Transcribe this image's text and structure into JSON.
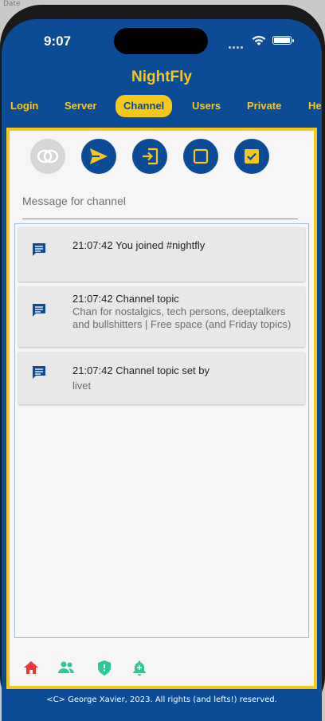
{
  "device_label": "Date",
  "status_bar": {
    "time": "9:07"
  },
  "app": {
    "title": "NightFly"
  },
  "tabs": [
    {
      "label": "Login"
    },
    {
      "label": "Server"
    },
    {
      "label": "Channel",
      "active": true
    },
    {
      "label": "Users"
    },
    {
      "label": "Private"
    },
    {
      "label": "He"
    }
  ],
  "toolbar": {
    "buttons": [
      {
        "icon": "eye-off-icon",
        "enabled": false
      },
      {
        "icon": "send-icon",
        "enabled": true
      },
      {
        "icon": "join-icon",
        "enabled": true
      },
      {
        "icon": "checkbox-empty-icon",
        "enabled": true
      },
      {
        "icon": "checkbox-checked-icon",
        "enabled": true
      }
    ]
  },
  "message_input": {
    "placeholder": "Message for channel",
    "value": ""
  },
  "messages": [
    {
      "icon": "message-icon",
      "title": "21:07:42 You joined #nightfly",
      "body": ""
    },
    {
      "icon": "message-icon",
      "title": "21:07:42 Channel topic",
      "body": "Chan for nostalgics, tech persons, deeptalkers and bullshitters | Free space (and Friday topics)"
    },
    {
      "icon": "message-icon",
      "title": "21:07:42 Channel topic set by",
      "body": "livet"
    }
  ],
  "bottom_nav": [
    {
      "icon": "home-icon",
      "color": "#e53935"
    },
    {
      "icon": "users-icon",
      "color": "#2ec79a"
    },
    {
      "icon": "shield-icon",
      "color": "#2ec79a"
    },
    {
      "icon": "bell-icon",
      "color": "#2ec79a"
    }
  ],
  "footer": {
    "text": "<C> George Xavier, 2023.  All rights (and lefts!) reserved."
  },
  "colors": {
    "primary": "#0c4c96",
    "accent": "#f7c81c",
    "surface": "#f6f6f6",
    "item_bg": "#e8e8e8"
  }
}
